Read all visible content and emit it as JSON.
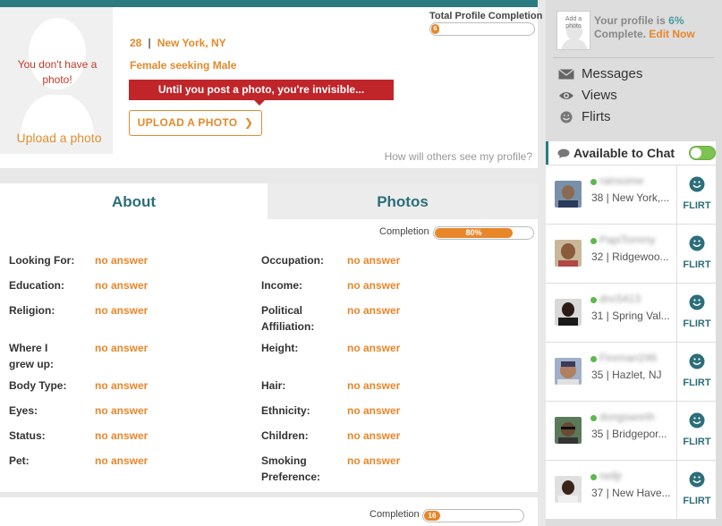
{
  "profile": {
    "no_photo_text": "You don't have a photo!",
    "upload_link": "Upload a photo",
    "age": "28",
    "location": "New York, NY",
    "seeking": "Female seeking Male",
    "invisible_banner": "Until you post a photo, you're invisible...",
    "upload_button": "UPLOAD A PHOTO",
    "how_others": "How will others see my profile?",
    "total_completion_label": "Total Profile Completion",
    "total_completion_value": "6",
    "total_completion_percent": 6
  },
  "tabs": {
    "about": "About",
    "photos": "Photos"
  },
  "about": {
    "completion_label": "Completion",
    "completion_value": "80%",
    "completion_percent": 80,
    "left_fields": [
      {
        "label": "Looking For:",
        "value": "no answer"
      },
      {
        "label": "Education:",
        "value": "no answer"
      },
      {
        "label": "Religion:",
        "value": "no answer"
      },
      {
        "label": "Where I grew up:",
        "value": "no answer"
      },
      {
        "label": "Body Type:",
        "value": "no answer"
      },
      {
        "label": "Eyes:",
        "value": "no answer"
      },
      {
        "label": "Status:",
        "value": "no answer"
      },
      {
        "label": "Pet:",
        "value": "no answer"
      }
    ],
    "right_fields": [
      {
        "label": "Occupation:",
        "value": "no answer"
      },
      {
        "label": "Income:",
        "value": "no answer"
      },
      {
        "label": "Political Affiliation:",
        "value": "no answer"
      },
      {
        "label": "Height:",
        "value": "no answer"
      },
      {
        "label": "Hair:",
        "value": "no answer"
      },
      {
        "label": "Ethnicity:",
        "value": "no answer"
      },
      {
        "label": "Children:",
        "value": "no answer"
      },
      {
        "label": "Smoking Preference:",
        "value": "no answer"
      }
    ]
  },
  "bottom": {
    "completion_label": "Completion",
    "completion_value": "16",
    "completion_percent": 16
  },
  "sidebar": {
    "add_photo_label": "Add a photo",
    "profile_is": "Your profile is",
    "profile_pct": "6%",
    "complete": "Complete.",
    "edit_now": "Edit Now",
    "nav": {
      "messages": "Messages",
      "views": "Views",
      "flirts": "Flirts"
    },
    "chat_title": "Available to Chat",
    "chat_users": [
      {
        "name": "rainsome",
        "info": "38 | New York,..."
      },
      {
        "name": "PapiTommy",
        "info": "32 | Ridgewoo..."
      },
      {
        "name": "dnc5413",
        "info": "31 | Spring Val..."
      },
      {
        "name": "Fireman246",
        "info": "35 | Hazlet, NJ"
      },
      {
        "name": "dongsworth",
        "info": "35 | Bridgepor..."
      },
      {
        "name": "nelljr",
        "info": "37 | New Have..."
      }
    ],
    "flirt_label": "FLIRT"
  },
  "colors": {
    "accent_orange": "#e8862a",
    "teal": "#2c7b80",
    "banner_red": "#c0252a",
    "online_green": "#5cb84c"
  }
}
